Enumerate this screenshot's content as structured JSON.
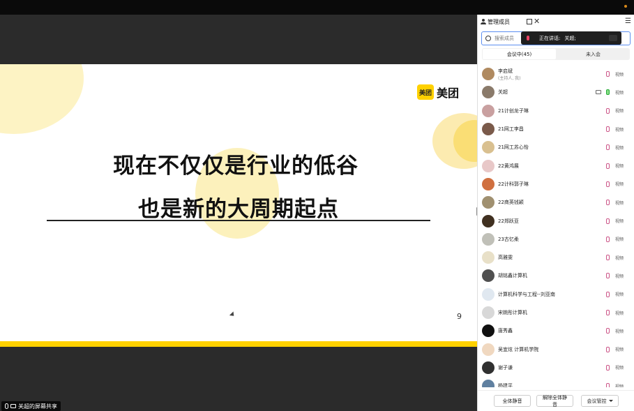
{
  "slide": {
    "logo_mark": "美团",
    "logo_word": "美团",
    "line1": "现在不仅仅是行业的低谷",
    "line2": "也是新的大周期起点",
    "page_number": "9",
    "brand_color": "#ffd100"
  },
  "share_label": "关超的屏幕共享",
  "panel": {
    "title": "管理成员",
    "search_placeholder": "搜索成员",
    "toast_label": "正在讲话:",
    "toast_name": "关超;",
    "tabs": [
      {
        "label": "会议中(45)",
        "active": true
      },
      {
        "label": "未入会",
        "active": false
      }
    ],
    "members": [
      {
        "name": "李启斌",
        "sub": "(主持人, 我)",
        "avatar": "#b08a60",
        "mic_on": false,
        "video": "视频",
        "has_cam": false
      },
      {
        "name": "关超",
        "sub": "",
        "avatar": "#8a7a6a",
        "mic_on": true,
        "video": "视频",
        "has_cam": true
      },
      {
        "name": "21计创龙子琳",
        "sub": "",
        "avatar": "#c9a0a0",
        "mic_on": false,
        "video": "视频",
        "has_cam": false
      },
      {
        "name": "21网工李昌",
        "sub": "",
        "avatar": "#7a5a4a",
        "mic_on": false,
        "video": "视频",
        "has_cam": false
      },
      {
        "name": "21网工苏心怡",
        "sub": "",
        "avatar": "#d9c090",
        "mic_on": false,
        "video": "视频",
        "has_cam": false
      },
      {
        "name": "22黄鸿展",
        "sub": "",
        "avatar": "#e8c8c8",
        "mic_on": false,
        "video": "视频",
        "has_cam": false
      },
      {
        "name": "22计科郭子琳",
        "sub": "",
        "avatar": "#d07040",
        "mic_on": false,
        "video": "视频",
        "has_cam": false
      },
      {
        "name": "22商英钱颖",
        "sub": "",
        "avatar": "#a09070",
        "mic_on": false,
        "video": "视频",
        "has_cam": false
      },
      {
        "name": "22郑跃亚",
        "sub": "",
        "avatar": "#403020",
        "mic_on": false,
        "video": "视频",
        "has_cam": false
      },
      {
        "name": "23古忆柔",
        "sub": "",
        "avatar": "#c0c0b8",
        "mic_on": false,
        "video": "视频",
        "has_cam": false
      },
      {
        "name": "高雅雯",
        "sub": "",
        "avatar": "#e8e0c8",
        "mic_on": false,
        "video": "视频",
        "has_cam": false
      },
      {
        "name": "胡铭鑫计算机",
        "sub": "",
        "avatar": "#505050",
        "mic_on": false,
        "video": "视频",
        "has_cam": false
      },
      {
        "name": "计算机科学与工程--刘亚南",
        "sub": "",
        "avatar": "#e0e8f0",
        "mic_on": false,
        "video": "视频",
        "has_cam": false
      },
      {
        "name": "宋婉彤计算机",
        "sub": "",
        "avatar": "#d8d8d8",
        "mic_on": false,
        "video": "视频",
        "has_cam": false
      },
      {
        "name": "唐秀鑫",
        "sub": "",
        "avatar": "#101010",
        "mic_on": false,
        "video": "视频",
        "has_cam": false
      },
      {
        "name": "吴宜炫 计算机学院",
        "sub": "",
        "avatar": "#f0d8c0",
        "mic_on": false,
        "video": "视频",
        "has_cam": false
      },
      {
        "name": "谢子谦",
        "sub": "",
        "avatar": "#303030",
        "mic_on": false,
        "video": "视频",
        "has_cam": false
      },
      {
        "name": "杨建平",
        "sub": "",
        "avatar": "#6080a0",
        "mic_on": false,
        "video": "视频",
        "has_cam": false
      }
    ],
    "footer": {
      "mute_all": "全体静音",
      "unmute_all": "解除全体静音",
      "meeting_control": "会议管控"
    }
  }
}
